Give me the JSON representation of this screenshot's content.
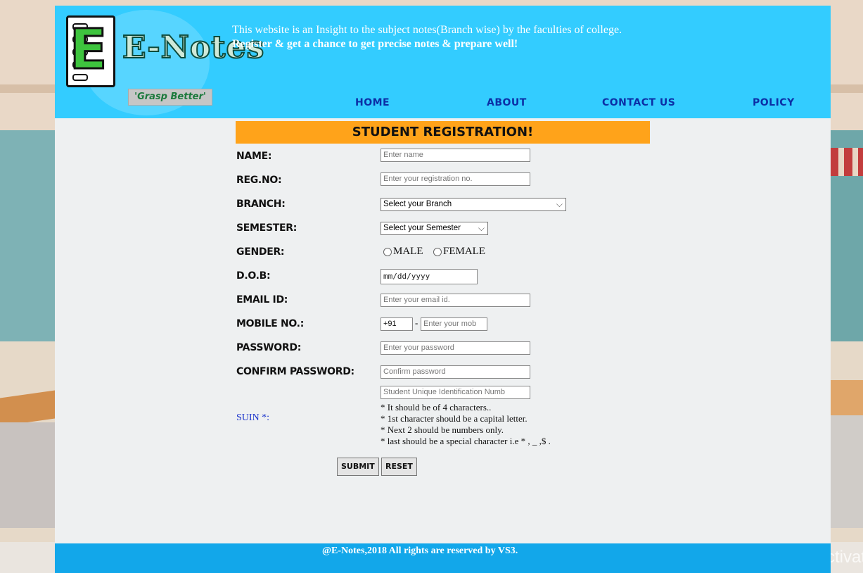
{
  "header": {
    "logo_text": "E-Notes",
    "logo_letter": "E",
    "tagline": "'Grasp Better'",
    "intro_line1": "This website is an Insight to the subject notes(Branch wise) by the faculties of college.",
    "intro_line2": "Register & get a chance to get precise notes & prepare well!"
  },
  "nav": [
    {
      "label": "HOME"
    },
    {
      "label": "ABOUT"
    },
    {
      "label": "CONTACT US"
    },
    {
      "label": "POLICY"
    }
  ],
  "form": {
    "title": "STUDENT REGISTRATION!",
    "name": {
      "label": "NAME:",
      "placeholder": "Enter name"
    },
    "regno": {
      "label": "REG.NO:",
      "placeholder": "Enter your registration no."
    },
    "branch": {
      "label": "BRANCH:",
      "selected": "Select your Branch"
    },
    "semester": {
      "label": "SEMESTER:",
      "selected": "Select your Semester"
    },
    "gender": {
      "label": "GENDER:",
      "option1": "MALE",
      "option2": "FEMALE"
    },
    "dob": {
      "label": "D.O.B:",
      "placeholder": "mm/dd/yyyy"
    },
    "email": {
      "label": "EMAIL ID:",
      "placeholder": "Enter your email id."
    },
    "mobile": {
      "label": "MOBILE NO.:",
      "code": "+91",
      "separator": "-",
      "placeholder": "Enter your mob"
    },
    "password": {
      "label": "PASSWORD:",
      "placeholder": "Enter your password"
    },
    "confirm": {
      "label": "CONFIRM PASSWORD:",
      "placeholder": "Confirm password"
    },
    "suin": {
      "label": "SUIN *:",
      "placeholder": "Student Unique Identification Numb",
      "rules": [
        "* It should be of 4 characters..",
        "* 1st character should be a capital letter.",
        "* Next 2 should be numbers only.",
        "* last should be a special character i.e * , _ ,$ ."
      ]
    },
    "submit_label": "SUBMIT",
    "reset_label": "RESET"
  },
  "footer": {
    "text": "@E-Notes,2018 All rights are reserved by VS3."
  },
  "watermark": "Activat",
  "colors": {
    "header": "#33ccff",
    "title_bar": "#ffa31a",
    "footer": "#12a7ea",
    "nav": "#0c2fa6"
  }
}
